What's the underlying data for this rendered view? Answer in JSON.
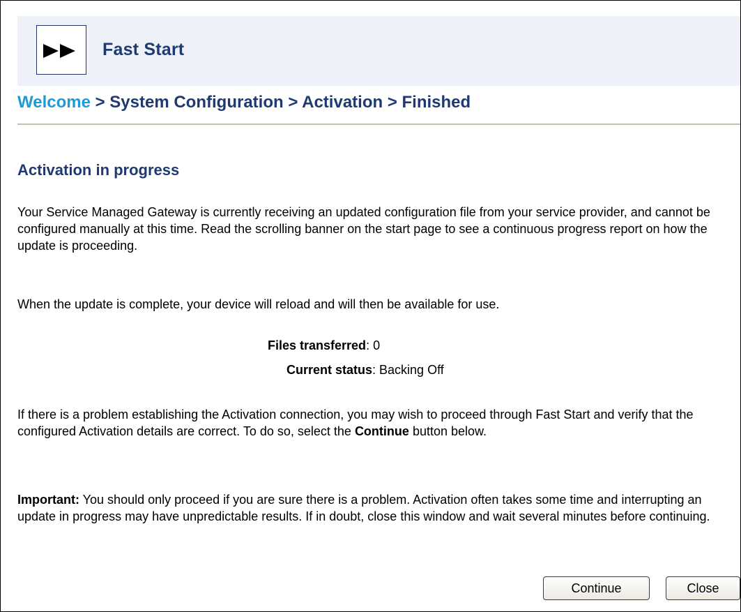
{
  "header": {
    "logo_icon": "fast-forward-icon",
    "title": "Fast Start"
  },
  "breadcrumb": {
    "items": [
      "Welcome",
      "System Configuration",
      "Activation",
      "Finished"
    ],
    "separator": ">"
  },
  "section": {
    "title": "Activation in progress"
  },
  "paragraphs": {
    "intro": "Your Service Managed Gateway is currently receiving an updated configuration file from your service provider, and cannot be configured manually at this time. Read the scrolling banner on the start page to see a continuous progress report on how the update is proceeding.",
    "reload": "When the update is complete, your device will reload and will then be available for use.",
    "problem_before": "If there is a problem establishing the Activation connection, you may wish to proceed through Fast Start and verify that the configured Activation details are correct. To do so, select the ",
    "problem_bold": "Continue",
    "problem_after": " button below.",
    "important_label": "Important:",
    "important_text": " You should only proceed if you are sure there is a problem. Activation often takes some time and interrupting an update in progress may have unpredictable results. If in doubt, close this window and wait several minutes before continuing."
  },
  "status": {
    "files_label": "Files transferred",
    "files_value": ": 0",
    "current_label": "Current status",
    "current_value": ": Backing Off"
  },
  "buttons": {
    "continue_label": "Continue",
    "close_label": "Close"
  },
  "colors": {
    "title_navy": "#1f3a72",
    "link_blue": "#1f9ad6",
    "header_bg": "#eef1f7",
    "divider": "#c7c0ad"
  }
}
